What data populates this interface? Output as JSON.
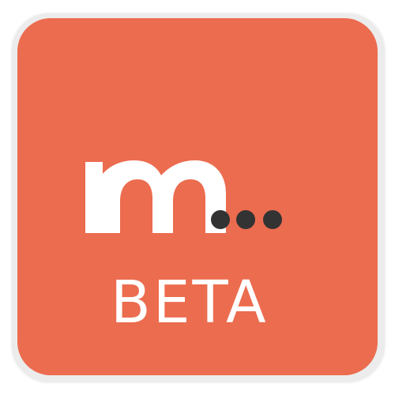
{
  "app_icon": {
    "logo_letter": "m",
    "logo_dots": "...",
    "beta_label": "BETA",
    "colors": {
      "background": "#ec6c4f",
      "letter": "#ffffff",
      "dots": "#333333",
      "beta_text": "#ffffff"
    }
  }
}
